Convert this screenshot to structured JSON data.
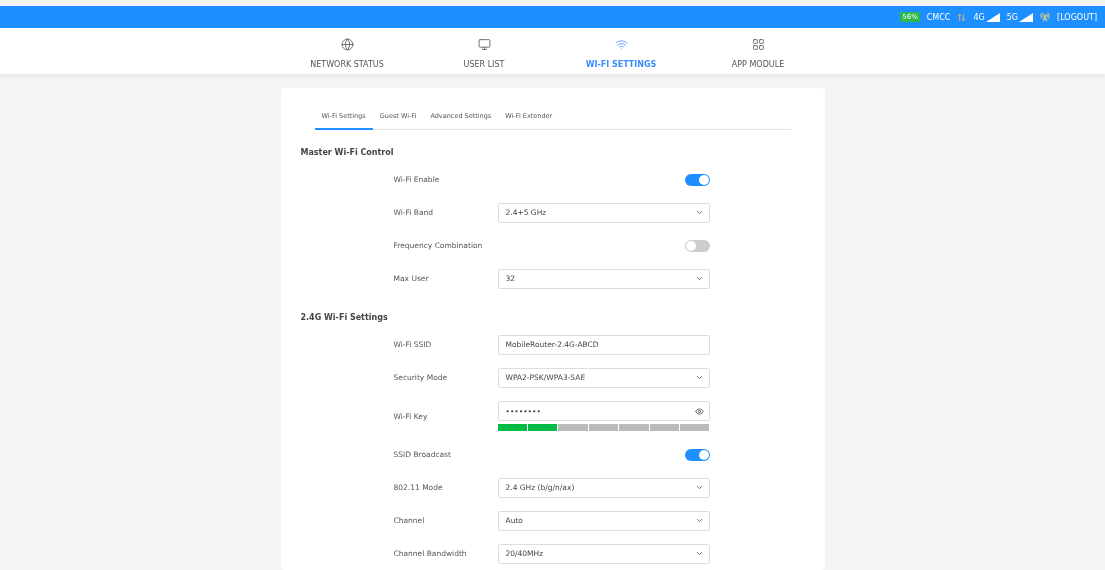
{
  "status_bar": {
    "battery": "56%",
    "carrier": "CMCC",
    "signals": [
      {
        "label": "4G"
      },
      {
        "label": "5G"
      }
    ],
    "logout": "[LOGOUT]"
  },
  "nav": [
    {
      "kind": "globe",
      "label": "NETWORK STATUS",
      "selected": false
    },
    {
      "kind": "monitor",
      "label": "USER LIST",
      "selected": false
    },
    {
      "kind": "wifi",
      "label": "WI-FI SETTINGS",
      "selected": true
    },
    {
      "kind": "apps",
      "label": "APP MODULE",
      "selected": false
    }
  ],
  "tabs": [
    {
      "label": "Wi-Fi Settings",
      "selected": true
    },
    {
      "label": "Guest Wi-Fi",
      "selected": false
    },
    {
      "label": "Advanced Settings",
      "selected": false
    },
    {
      "label": "Wi-Fi Extender",
      "selected": false
    }
  ],
  "sections": [
    {
      "title": "Master Wi-Fi Control",
      "rows": [
        {
          "kind": "toggle",
          "label": "Wi-Fi Enable",
          "on": true
        },
        {
          "kind": "select",
          "label": "Wi-Fi Band",
          "value": "2.4+5 GHz"
        },
        {
          "kind": "toggle",
          "label": "Frequency Combination",
          "on": false
        },
        {
          "kind": "select",
          "label": "Max User",
          "value": "32"
        }
      ]
    },
    {
      "title": "2.4G Wi-Fi Settings",
      "rows": [
        {
          "kind": "text",
          "label": "Wi-Fi SSID",
          "value": "MobileRouter-2.4G-ABCD"
        },
        {
          "kind": "select",
          "label": "Security Mode",
          "value": "WPA2-PSK/WPA3-SAE"
        },
        {
          "kind": "password",
          "label": "Wi-Fi Key",
          "value": "••••••••",
          "level": 0.2857
        },
        {
          "kind": "toggle",
          "label": "SSID Broadcast",
          "on": true
        },
        {
          "kind": "select",
          "label": "802.11 Mode",
          "value": "2.4 GHz (b/g/n/ax)"
        },
        {
          "kind": "select",
          "label": "Channel",
          "value": "Auto"
        },
        {
          "kind": "select",
          "label": "Channel Bandwidth",
          "value": "20/40MHz"
        }
      ]
    }
  ]
}
